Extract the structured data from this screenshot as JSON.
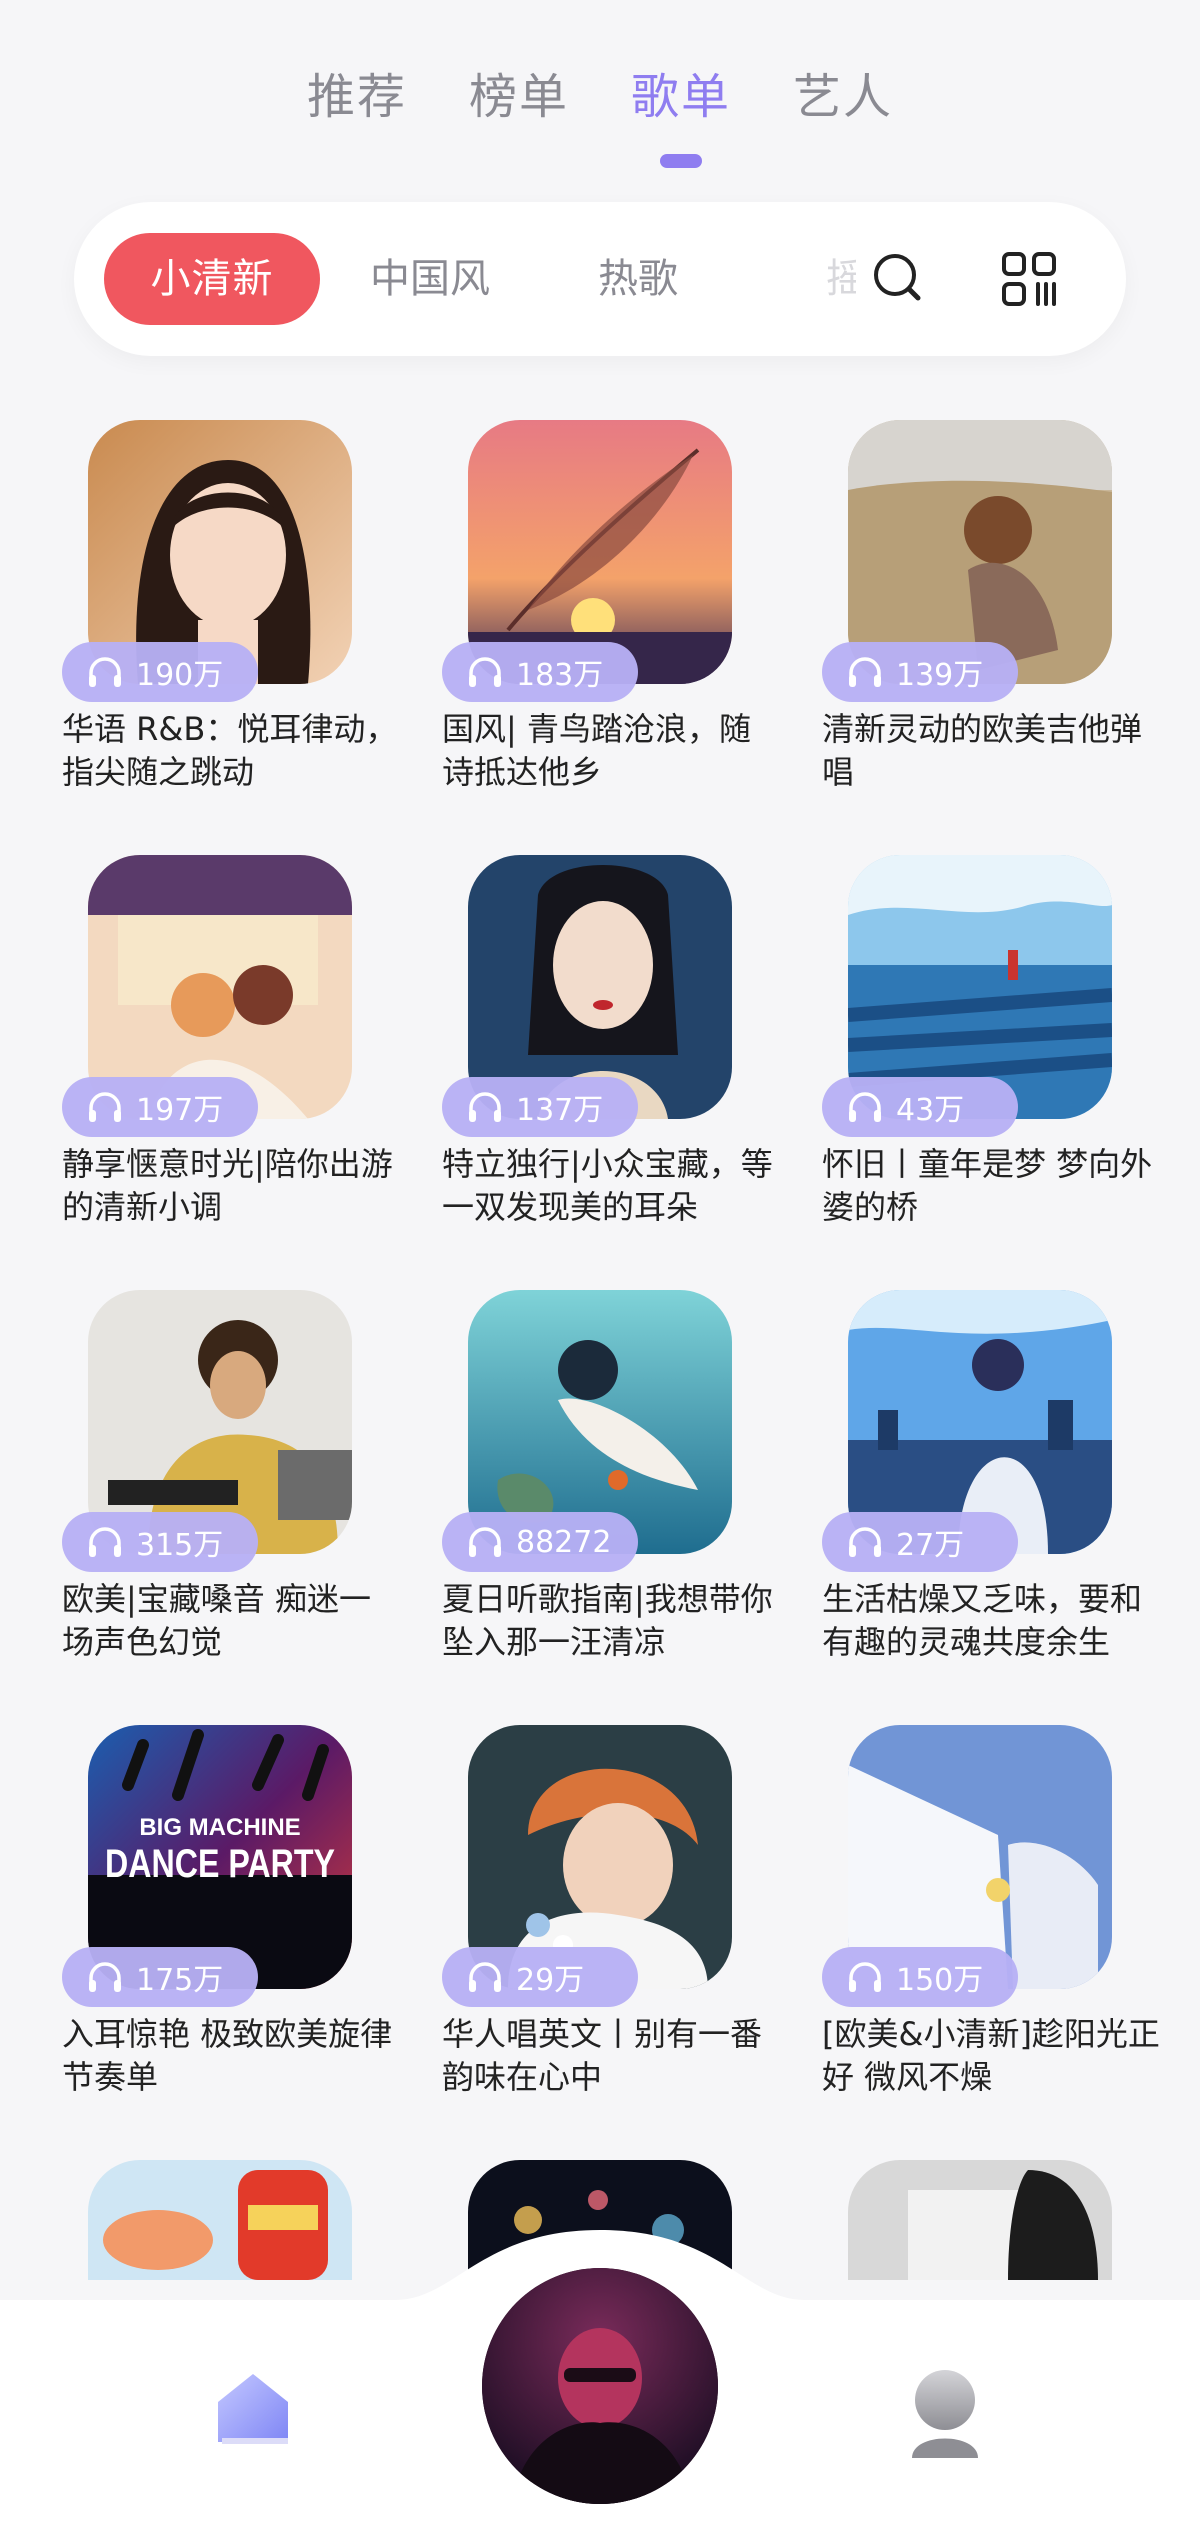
{
  "top_tabs": [
    {
      "label": "推荐",
      "active": false
    },
    {
      "label": "榜单",
      "active": false
    },
    {
      "label": "歌单",
      "active": true
    },
    {
      "label": "艺人",
      "active": false
    }
  ],
  "categories": {
    "selected": "小清新",
    "items": [
      "中国风",
      "热歌"
    ],
    "partial": "摇"
  },
  "playlists": [
    {
      "plays": "190万",
      "title": "华语 R&B：悦耳律动，指尖随之跳动"
    },
    {
      "plays": "183万",
      "title": "国风| 青鸟踏沧浪，随诗抵达他乡"
    },
    {
      "plays": "139万",
      "title": "清新灵动的欧美吉他弹唱"
    },
    {
      "plays": "197万",
      "title": "静享惬意时光|陪你出游的清新小调"
    },
    {
      "plays": "137万",
      "title": "特立独行|小众宝藏，等一双发现美的耳朵"
    },
    {
      "plays": "43万",
      "title": "怀旧丨童年是梦 梦向外婆的桥"
    },
    {
      "plays": "315万",
      "title": "欧美|宝藏嗓音 痴迷一场声色幻觉"
    },
    {
      "plays": "88272",
      "title": "夏日听歌指南|我想带你坠入那一汪清凉"
    },
    {
      "plays": "27万",
      "title": "生活枯燥又乏味，要和有趣的灵魂共度余生"
    },
    {
      "plays": "175万",
      "title": "入耳惊艳 极致欧美旋律节奏单"
    },
    {
      "plays": "29万",
      "title": "华人唱英文丨别有一番韵味在心中"
    },
    {
      "plays": "150万",
      "title": "[欧美&小清新]趁阳光正好 微风不燥"
    }
  ],
  "cover_texts": {
    "dance_line1": "BIG MACHINE",
    "dance_line2": "DANCE PARTY"
  },
  "colors": {
    "accent": "#8f7df0",
    "selected_pill": "#f0575f",
    "badge": "#b7b0f5",
    "background": "#f6f6f8"
  },
  "icons": {
    "search": "search-icon",
    "grid": "grid-icon",
    "headphones": "headphones-icon",
    "home": "home-icon",
    "profile": "profile-icon"
  }
}
